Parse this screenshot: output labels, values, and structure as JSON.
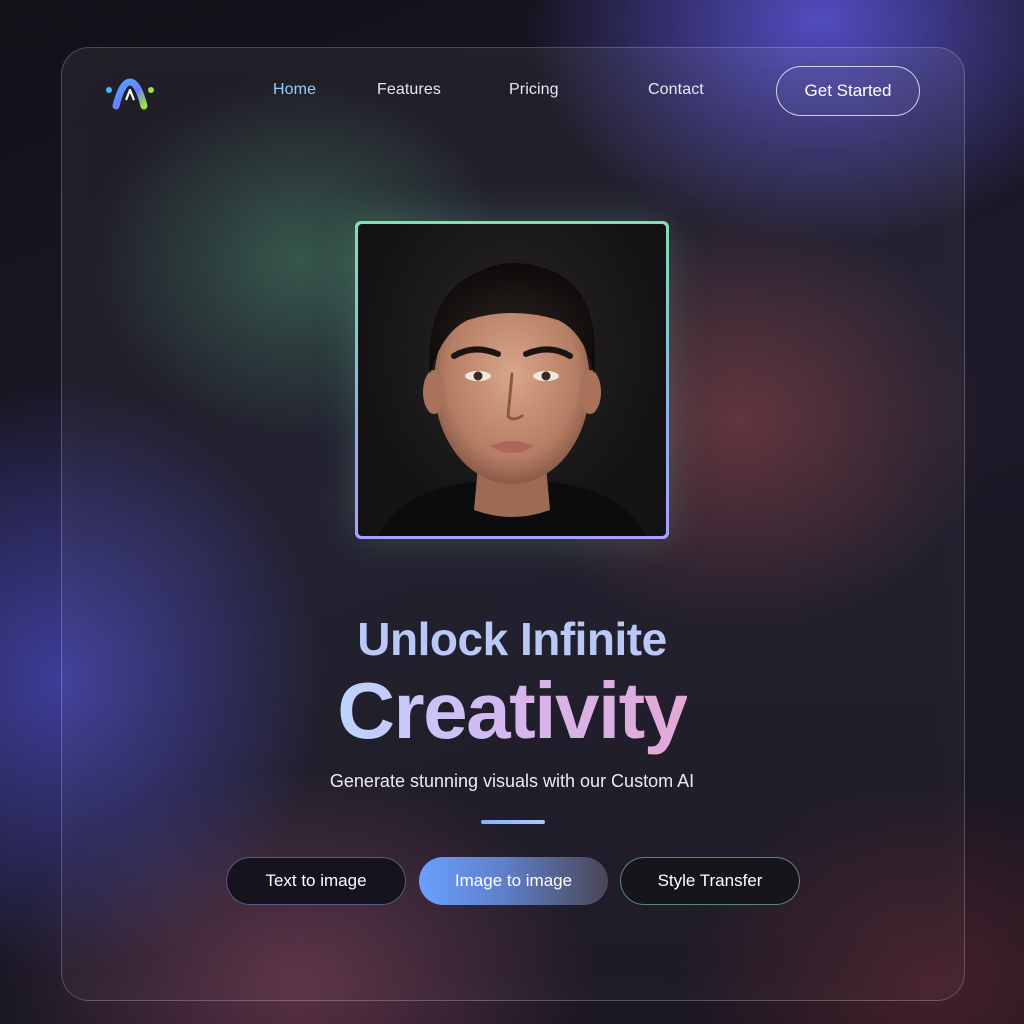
{
  "brand": {
    "logo_icon": "ai-logo-icon"
  },
  "nav": {
    "items": [
      {
        "label": "Home",
        "active": true
      },
      {
        "label": "Features",
        "active": false
      },
      {
        "label": "Pricing",
        "active": false
      },
      {
        "label": "Contact",
        "active": false
      }
    ],
    "cta_label": "Get Started"
  },
  "hero": {
    "headline_line1": "Unlock Infinite",
    "headline_line2": "Creativity",
    "subtitle": "Generate stunning visuals with our Custom AI"
  },
  "modes": [
    {
      "label": "Text to image",
      "selected": false
    },
    {
      "label": "Image to image",
      "selected": true
    },
    {
      "label": "Style Transfer",
      "selected": false
    }
  ],
  "colors": {
    "accent_blue": "#8fd0ff",
    "accent_green": "#7fe0b0",
    "accent_pink": "#e3a8d8"
  }
}
